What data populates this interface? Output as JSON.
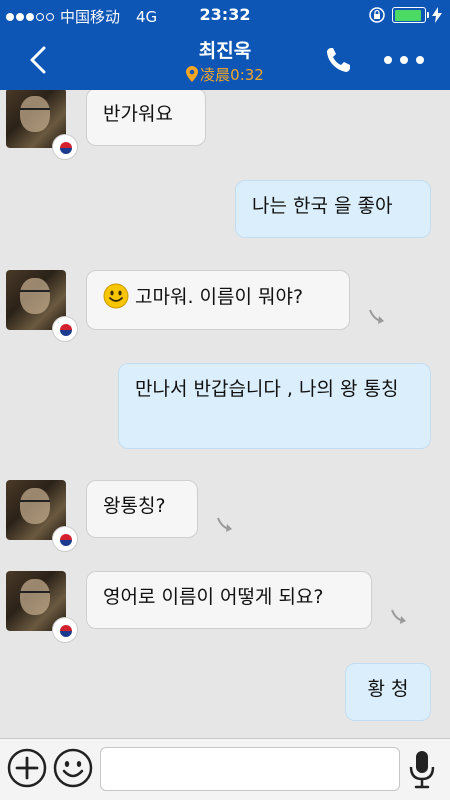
{
  "status_bar": {
    "carrier": "中国移动",
    "network": "4G",
    "time": "23:32",
    "signal_bars_filled": 3,
    "signal_bars_total": 5,
    "battery_level": 0.9
  },
  "header": {
    "title": "최진욱",
    "subtitle": "凌晨0:32",
    "back_icon": "chevron-left-icon",
    "call_icon": "phone-icon",
    "more_icon": "more-dots-icon"
  },
  "messages": [
    {
      "side": "in",
      "text": "반가워요"
    },
    {
      "side": "out",
      "text": "나는 한국 을 좋아"
    },
    {
      "side": "in",
      "text": "고마워. 이름이 뭐야?",
      "emoji": "smiley-icon",
      "translate": true
    },
    {
      "side": "out",
      "text": "만나서 반갑습니다 , 나의 왕 통칭"
    },
    {
      "side": "in",
      "text": "왕통칭?",
      "translate": true
    },
    {
      "side": "in",
      "text": "영어로 이름이 어떻게 되요?",
      "translate": true
    },
    {
      "side": "out",
      "text": "황 청"
    }
  ],
  "input_bar": {
    "plus_icon": "plus-circle-icon",
    "emoji_icon": "smiley-icon",
    "mic_icon": "microphone-icon",
    "value": ""
  },
  "colors": {
    "header_bg": "#0e56b6",
    "chat_bg": "#e6e6e6",
    "incoming_bubble": "#f6f6f6",
    "outgoing_bubble": "#dbeefc",
    "subtitle_color": "#f5a623"
  }
}
